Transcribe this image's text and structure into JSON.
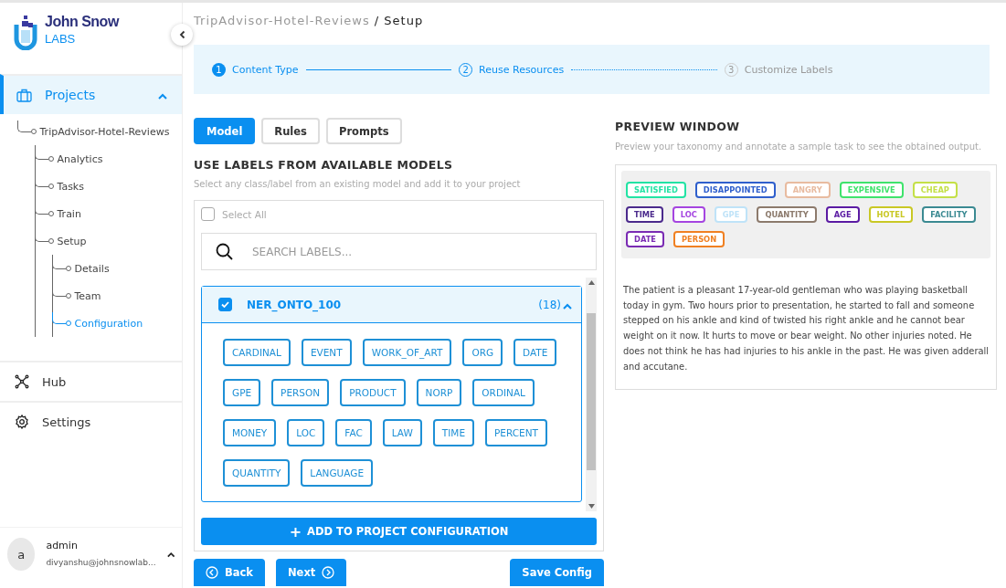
{
  "logo": {
    "name": "John Snow",
    "sub": "LABS"
  },
  "nav": [
    {
      "label": "Projects",
      "kind": "tree",
      "selected": true,
      "expanded": true,
      "tree": [
        {
          "label": "TripAdvisor-Hotel-Reviews",
          "selected": false,
          "children": [
            {
              "label": "Analytics",
              "selected": false
            },
            {
              "label": "Tasks",
              "selected": false
            },
            {
              "label": "Train",
              "selected": false
            },
            {
              "label": "Setup",
              "selected": false,
              "children": [
                {
                  "label": "Details",
                  "selected": false
                },
                {
                  "label": "Team",
                  "selected": false
                },
                {
                  "label": "Configuration",
                  "selected": true
                }
              ]
            }
          ]
        }
      ]
    },
    {
      "label": "Hub",
      "kind": "hub",
      "selected": false
    },
    {
      "label": "Settings",
      "kind": "settings",
      "selected": false
    }
  ],
  "user": {
    "avatar": "a",
    "name": "admin",
    "email": "divyanshu@johnsnowlab..."
  },
  "breadcrumb": {
    "parent": "TripAdvisor-Hotel-Reviews",
    "separator": "/",
    "current": "Setup"
  },
  "steps": [
    {
      "number": "1",
      "label": "Content Type",
      "completed": true,
      "selected": false
    },
    {
      "number": "2",
      "label": "Reuse Resources",
      "completed": false,
      "selected": true
    },
    {
      "number": "3",
      "label": "Customize Labels",
      "completed": false,
      "selected": false
    }
  ],
  "tabs": [
    {
      "label": "Model",
      "selected": true
    },
    {
      "label": "Rules",
      "selected": false
    },
    {
      "label": "Prompts",
      "selected": false
    }
  ],
  "section": {
    "title": "USE LABELS FROM AVAILABLE MODELS",
    "subtitle": "Select any class/label from an existing model and add it to your project"
  },
  "select_all": {
    "label": "Select All",
    "checked": false
  },
  "search": {
    "placeholder": "SEARCH LABELS..."
  },
  "models": [
    {
      "name": "NER_ONTO_100",
      "count": "(18)",
      "checked": true,
      "expanded": true,
      "labels": [
        "CARDINAL",
        "EVENT",
        "WORK_OF_ART",
        "ORG",
        "DATE",
        "GPE",
        "PERSON",
        "PRODUCT",
        "NORP",
        "ORDINAL",
        "MONEY",
        "LOC",
        "FAC",
        "LAW",
        "TIME",
        "PERCENT",
        "QUANTITY",
        "LANGUAGE"
      ]
    }
  ],
  "add_button": {
    "icon": "+",
    "label": "ADD TO PROJECT CONFIGURATION"
  },
  "buttons": {
    "back": "Back",
    "next": "Next",
    "save": "Save Config"
  },
  "preview": {
    "title": "PREVIEW WINDOW",
    "subtitle": "Preview your taxonomy and annotate a sample task to see the obtained output.",
    "labels": [
      {
        "text": "SATISFIED",
        "color": "#22e3a4"
      },
      {
        "text": "DISAPPOINTED",
        "color": "#2f5fcc"
      },
      {
        "text": "ANGRY",
        "color": "#e8bba0"
      },
      {
        "text": "EXPENSIVE",
        "color": "#3fe36c"
      },
      {
        "text": "CHEAP",
        "color": "#c4e048"
      },
      {
        "text": "TIME",
        "color": "#4b2a8c"
      },
      {
        "text": "LOC",
        "color": "#a545e0"
      },
      {
        "text": "GPE",
        "color": "#bfe3f8"
      },
      {
        "text": "QUANTITY",
        "color": "#8c7a6c"
      },
      {
        "text": "AGE",
        "color": "#5b1ba3"
      },
      {
        "text": "HOTEL",
        "color": "#c9c825"
      },
      {
        "text": "FACILITY",
        "color": "#3b8a92"
      },
      {
        "text": "DATE",
        "color": "#7a2bb3"
      },
      {
        "text": "PERSON",
        "color": "#f08022"
      }
    ],
    "text": "The patient is a pleasant 17-year-old gentleman who was playing basketball today in gym. Two hours prior to presentation, he started to fall and someone stepped on his ankle and kind of twisted his right ankle and he cannot bear weight on it now. It hurts to move or bear weight. No other injuries noted. He does not think he has had injuries to his ankle in the past. He was given adderall and accutane."
  }
}
